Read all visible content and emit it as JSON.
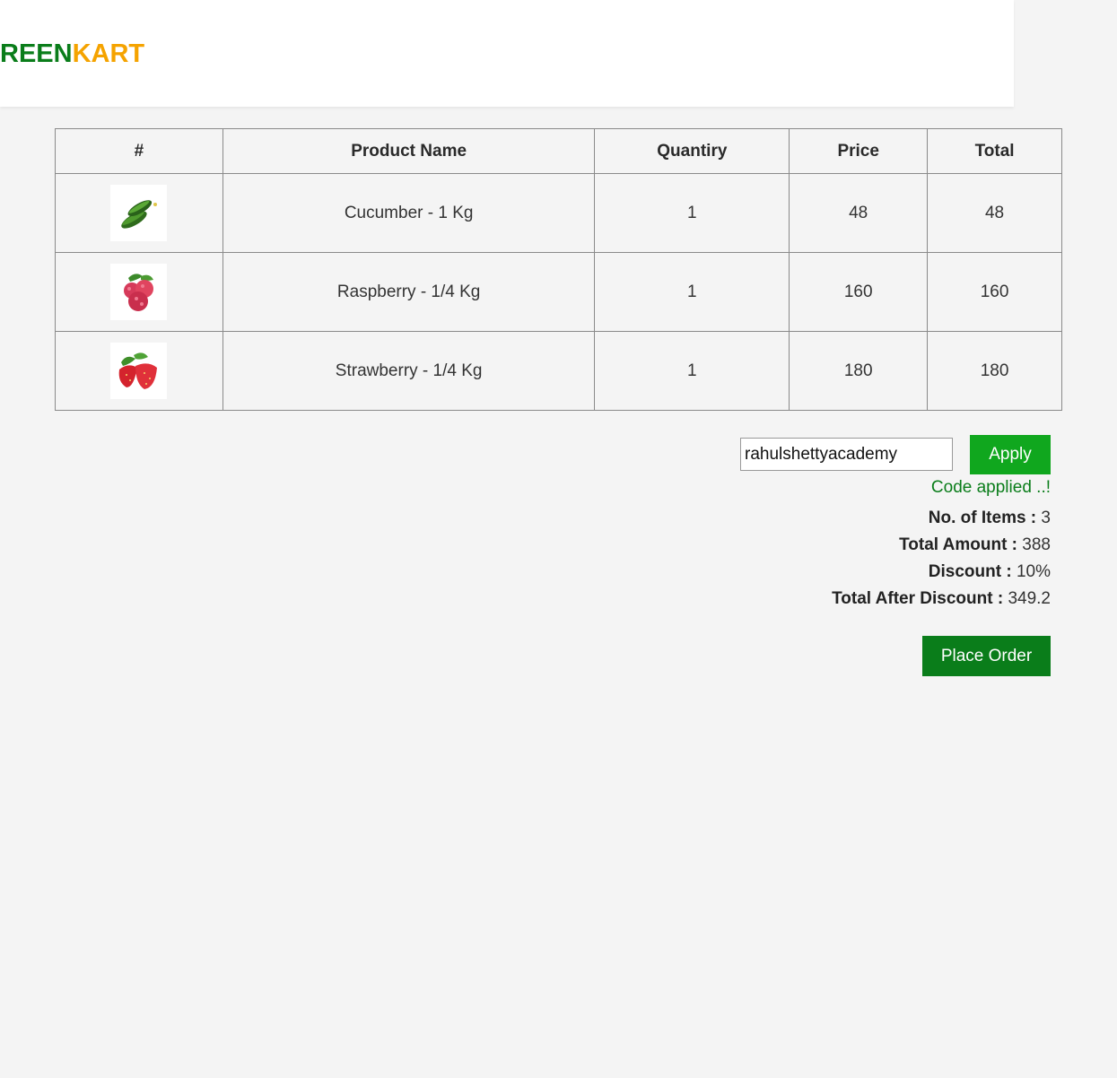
{
  "brand": {
    "part1": "REEN",
    "part2": "KART"
  },
  "table": {
    "headers": [
      "#",
      "Product Name",
      "Quantiry",
      "Price",
      "Total"
    ],
    "rows": [
      {
        "image": "cucumber-image",
        "name": "Cucumber - 1 Kg",
        "quantity": "1",
        "price": "48",
        "total": "48"
      },
      {
        "image": "raspberry-image",
        "name": "Raspberry - 1/4 Kg",
        "quantity": "1",
        "price": "160",
        "total": "160"
      },
      {
        "image": "strawberry-image",
        "name": "Strawberry - 1/4 Kg",
        "quantity": "1",
        "price": "180",
        "total": "180"
      }
    ]
  },
  "promo": {
    "code_value": "rahulshettyacademy",
    "apply_label": "Apply",
    "info": "Code applied ..!"
  },
  "summary": {
    "items_label": "No. of Items :",
    "items_value": "3",
    "total_label": "Total Amount :",
    "total_value": "388",
    "discount_label": "Discount :",
    "discount_value": "10%",
    "after_label": "Total After Discount :",
    "after_value": "349.2"
  },
  "place_order_label": "Place Order",
  "colors": {
    "green": "#0a7d1a",
    "orange": "#f5a300",
    "apply_green": "#10a71e",
    "background": "#f4f4f4"
  }
}
